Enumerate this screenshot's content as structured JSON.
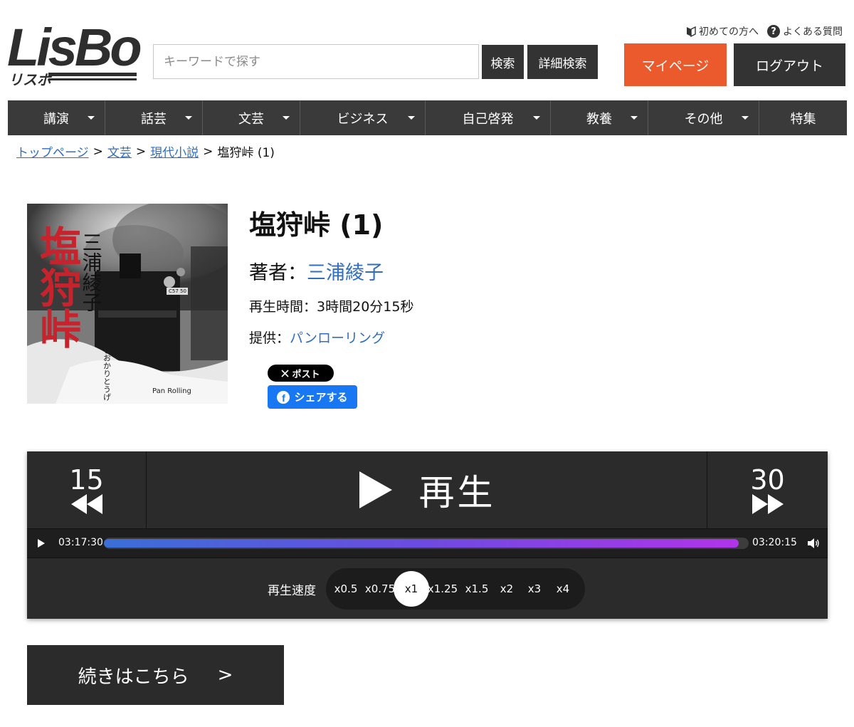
{
  "logo": {
    "main": "LisBo",
    "sub": "リスボ"
  },
  "header": {
    "search_placeholder": "キーワードで探す",
    "search_button": "検索",
    "advanced_search_button": "詳細検索",
    "mypage_button": "マイページ",
    "logout_button": "ログアウト",
    "first_time_link": "初めての方へ",
    "faq_link": "よくある質問"
  },
  "nav": {
    "items": [
      {
        "label": "講演"
      },
      {
        "label": "話芸"
      },
      {
        "label": "文芸"
      },
      {
        "label": "ビジネス"
      },
      {
        "label": "自己啓発"
      },
      {
        "label": "教養"
      },
      {
        "label": "その他"
      },
      {
        "label": "特集"
      }
    ]
  },
  "breadcrumb": {
    "items": [
      "トップページ",
      "文芸",
      "現代小説"
    ],
    "separator": ">",
    "current": "塩狩峠 (1)"
  },
  "product": {
    "title": "塩狩峠 (1)",
    "author_label": "著者：",
    "author_name": "三浦綾子",
    "duration_label": "再生時間：",
    "duration_value": "3時間20分15秒",
    "provider_label": "提供：",
    "provider_name": "パンローリング",
    "cover": {
      "title_text": "塩狩峠",
      "author_text": "三浦綾子",
      "reading_text": "しおかりとうげ",
      "publisher_text": "Pan Rolling",
      "plate_text": "C57 50"
    }
  },
  "social": {
    "x_post_label": "ポスト",
    "fb_share_label": "シェアする"
  },
  "player": {
    "skip_back": "15",
    "skip_forward": "30",
    "play_label": "再生",
    "current_time": "03:17:30",
    "total_time": "03:20:15",
    "progress": 0.985,
    "speed_label": "再生速度",
    "speeds": [
      "x0.5",
      "x0.75",
      "x1",
      "x1.25",
      "x1.5",
      "x2",
      "x3",
      "x4"
    ],
    "active_speed": "x1"
  },
  "continue_button": {
    "label": "続きはこちら",
    "arrow": ">"
  }
}
